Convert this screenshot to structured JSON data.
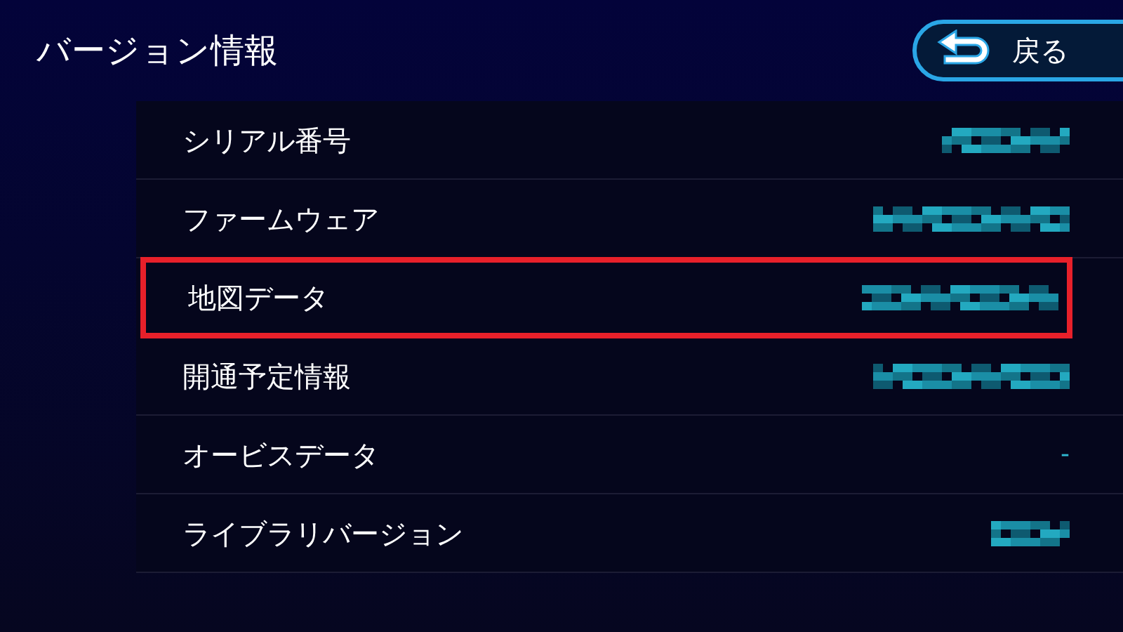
{
  "header": {
    "title": "バージョン情報",
    "back_button": {
      "label": "戻る"
    }
  },
  "rows": [
    {
      "label": "シリアル番号",
      "value": {
        "kind": "redacted"
      },
      "highlighted": false
    },
    {
      "label": "ファームウェア",
      "value": {
        "kind": "redacted"
      },
      "highlighted": false
    },
    {
      "label": "地図データ",
      "value": {
        "kind": "redacted"
      },
      "highlighted": true
    },
    {
      "label": "開通予定情報",
      "value": {
        "kind": "redacted"
      },
      "highlighted": false
    },
    {
      "label": "オービスデータ",
      "value": {
        "kind": "text",
        "text": "-"
      },
      "highlighted": false
    },
    {
      "label": "ライブラリバージョン",
      "value": {
        "kind": "redacted"
      },
      "highlighted": false
    }
  ]
}
